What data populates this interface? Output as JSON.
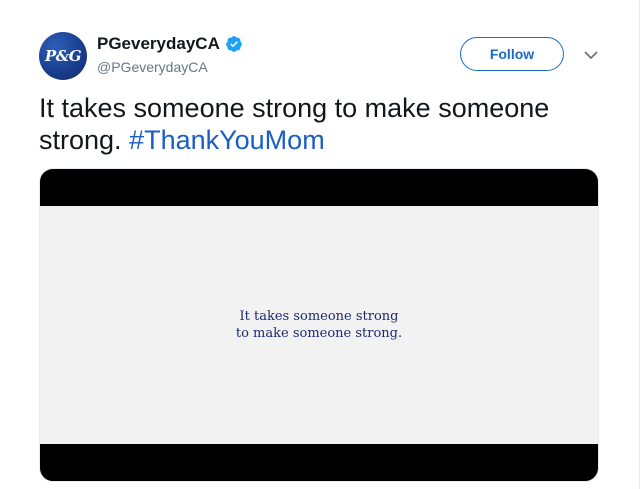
{
  "account": {
    "display_name": "PGeverydayCA",
    "handle": "@PGeverydayCA",
    "avatar_text": "P&G",
    "verified": true
  },
  "actions": {
    "follow_label": "Follow"
  },
  "tweet": {
    "text": "It takes someone strong to make someone strong.",
    "hashtag": "#ThankYouMom"
  },
  "media": {
    "line1": "It takes someone strong",
    "line2": "to make someone strong."
  },
  "colors": {
    "accent": "#1b6ac9",
    "hashtag": "#1b5ec4",
    "avatar_bg": "#1a3f8f",
    "video_text": "#1c2a6e"
  }
}
